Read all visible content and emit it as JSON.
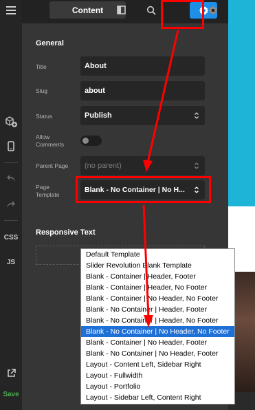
{
  "topbar": {
    "content_tab_label": "Content"
  },
  "rail": {
    "css_label": "CSS",
    "js_label": "JS",
    "save_label": "Save"
  },
  "panel": {
    "general_title": "General",
    "title_label": "Title",
    "title_value": "About",
    "slug_label": "Slug",
    "slug_value": "about",
    "status_label": "Status",
    "status_value": "Publish",
    "allow_comments_label_1": "Allow",
    "allow_comments_label_2": "Comments",
    "allow_comments_on": false,
    "parent_page_label": "Parent Page",
    "parent_page_value": "(no parent)",
    "page_template_label_1": "Page",
    "page_template_label_2": "Template",
    "page_template_value": "Blank - No Container | No H...",
    "responsive_title": "Responsive Text"
  },
  "dropdown": {
    "options": [
      "Default Template",
      "Slider Revolution Blank Template",
      "Blank - Container | Header, Footer",
      "Blank - Container | Header, No Footer",
      "Blank - Container | No Header, No Footer",
      "Blank - No Container | Header, Footer",
      "Blank - No Container | Header, No Footer",
      "Blank - No Container | No Header, No Footer",
      "Blank - Container | No Header, Footer",
      "Blank - No Container | No Header, Footer",
      "Layout - Content Left, Sidebar Right",
      "Layout - Fullwidth",
      "Layout - Portfolio",
      "Layout - Sidebar Left, Content Right"
    ],
    "selected_index": 7
  },
  "colors": {
    "accent": "#1f8ee6",
    "annotation": "#ff0000",
    "selection": "#1e6fd6",
    "save": "#4caf50"
  }
}
